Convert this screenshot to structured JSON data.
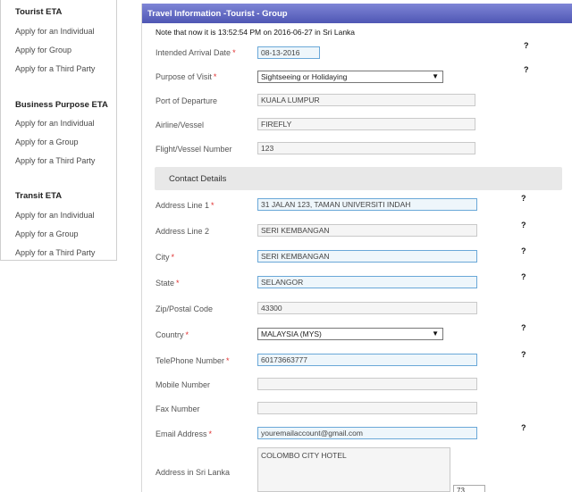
{
  "sidebar": {
    "sections": [
      {
        "title": "Tourist ETA",
        "items": [
          "Apply for an Individual",
          "Apply for Group",
          "Apply for a Third Party"
        ]
      },
      {
        "title": "Business Purpose ETA",
        "items": [
          "Apply for an Individual",
          "Apply for a Group",
          "Apply for a Third Party"
        ]
      },
      {
        "title": "Transit ETA",
        "items": [
          "Apply for an Individual",
          "Apply for a Group",
          "Apply for a Third Party"
        ]
      }
    ]
  },
  "header": {
    "title": "Travel Information -Tourist - Group"
  },
  "note": "Note that now it is 13:52:54 PM on 2016-06-27 in Sri Lanka",
  "fields": {
    "arrival": {
      "label": "Intended Arrival Date",
      "value": "08-13-2016",
      "required": "*"
    },
    "purpose": {
      "label": "Purpose of Visit",
      "value": "Sightseeing or Holidaying",
      "required": "*"
    },
    "departure": {
      "label": "Port of Departure",
      "value": "KUALA LUMPUR"
    },
    "airline": {
      "label": "Airline/Vessel",
      "value": "FIREFLY"
    },
    "flight": {
      "label": "Flight/Vessel Number",
      "value": "123"
    },
    "address1": {
      "label": "Address Line 1",
      "value": "31 JALAN 123, TAMAN UNIVERSITI INDAH",
      "required": "*"
    },
    "address2": {
      "label": "Address Line 2",
      "value": "SERI KEMBANGAN"
    },
    "city": {
      "label": "City",
      "value": "SERI KEMBANGAN",
      "required": "*"
    },
    "state": {
      "label": "State",
      "value": "SELANGOR",
      "required": "*"
    },
    "zip": {
      "label": "Zip/Postal Code",
      "value": "43300"
    },
    "country": {
      "label": "Country",
      "value": "MALAYSIA (MYS)",
      "required": "*"
    },
    "telephone": {
      "label": "TelePhone Number",
      "value": "60173663777",
      "required": "*"
    },
    "mobile": {
      "label": "Mobile Number",
      "value": ""
    },
    "fax": {
      "label": "Fax Number",
      "value": ""
    },
    "email": {
      "label": "Email Address",
      "value": "youremailaccount@gmail.com",
      "required": "*"
    },
    "address_sl": {
      "label": "Address in Sri Lanka",
      "value": "COLOMBO CITY HOTEL"
    }
  },
  "contact_section": "Contact Details",
  "help_glyph": "?",
  "dropdown_arrow": "▼",
  "char_count": "73",
  "colors": {
    "header_top": "#7e85d6",
    "header_bottom": "#4f57b4",
    "required": "#e03030",
    "highlight_border": "#6aa8d8"
  }
}
